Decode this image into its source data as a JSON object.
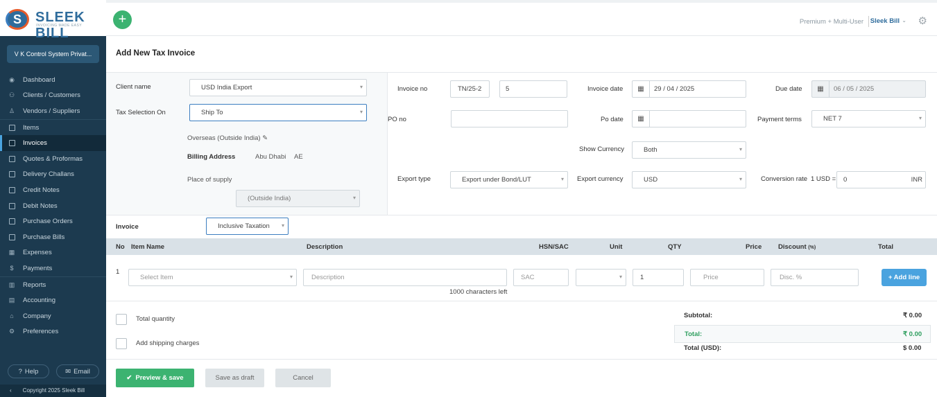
{
  "brand": {
    "badge": "S",
    "name": "SLEEK BILL",
    "tagline": "INVOICING MADE EASY"
  },
  "sidebar": {
    "company": "V K Control System Privat...",
    "items": [
      {
        "label": "Dashboard",
        "icon": "eye-icon"
      },
      {
        "label": "Clients / Customers",
        "icon": "users-icon"
      },
      {
        "label": "Vendors / Suppliers",
        "icon": "user-icon"
      },
      {
        "label": "Items",
        "icon": "box-icon"
      },
      {
        "label": "Invoices",
        "icon": "invoice-icon"
      },
      {
        "label": "Quotes & Proformas",
        "icon": "quote-icon"
      },
      {
        "label": "Delivery Challans",
        "icon": "delivery-icon"
      },
      {
        "label": "Credit Notes",
        "icon": "credit-note-icon"
      },
      {
        "label": "Debit Notes",
        "icon": "debit-note-icon"
      },
      {
        "label": "Purchase Orders",
        "icon": "purchase-order-icon"
      },
      {
        "label": "Purchase Bills",
        "icon": "purchase-bill-icon"
      },
      {
        "label": "Expenses",
        "icon": "expenses-icon"
      },
      {
        "label": "Payments",
        "icon": "dollar-icon"
      },
      {
        "label": "Reports",
        "icon": "chart-icon"
      },
      {
        "label": "Accounting",
        "icon": "accounting-icon"
      },
      {
        "label": "Company",
        "icon": "bank-icon"
      },
      {
        "label": "Preferences",
        "icon": "preferences-icon"
      }
    ],
    "help": "Help",
    "email": "Email",
    "copyright": "Copyright 2025 Sleek Bill"
  },
  "topbar": {
    "plan": "Premium + Multi-User",
    "user": "Sleek Bill"
  },
  "page": {
    "title": "Add New Tax Invoice"
  },
  "client": {
    "client_label": "Client name",
    "client_value": "USD India Export",
    "tax_label": "Tax Selection On",
    "tax_value": "Ship To",
    "overseas": "Overseas (Outside India)",
    "billing_label": "Billing Address",
    "billing_city": "Abu Dhabi",
    "billing_country": "AE",
    "supply_label": "Place of supply",
    "supply_value": "(Outside India)"
  },
  "invoice_info": {
    "invoice_no_label": "Invoice no",
    "invoice_prefix": "TN/25-2",
    "invoice_number": "5",
    "invoice_date_label": "Invoice date",
    "invoice_date": "29 / 04 / 2025",
    "due_date_label": "Due date",
    "due_date": "06 / 05 / 2025",
    "po_no_label": "PO no",
    "po_date_label": "Po date",
    "payment_terms_label": "Payment terms",
    "payment_terms": "NET 7",
    "show_currency_label": "Show Currency",
    "show_currency": "Both",
    "export_type_label": "Export type",
    "export_type": "Export under Bond/LUT",
    "export_currency_label": "Export currency",
    "export_currency": "USD",
    "conversion_label": "Conversion rate",
    "conversion_prefix": "1 USD =",
    "conversion_value": "0",
    "conversion_suffix": "INR"
  },
  "items": {
    "invoice_label": "Invoice",
    "taxation": "Inclusive Taxation",
    "headers": {
      "no": "No",
      "item": "Item Name",
      "desc": "Description",
      "hsn": "HSN/SAC",
      "unit": "Unit",
      "qty": "QTY",
      "price": "Price",
      "discount": "Discount",
      "discount_unit": "(%)",
      "total": "Total"
    },
    "row": {
      "no": "1",
      "item_placeholder": "Select Item",
      "desc_placeholder": "Description",
      "hsn_placeholder": "SAC",
      "qty": "1",
      "price_placeholder": "Price",
      "disc_placeholder": "Disc. %",
      "chars_left": "1000 characters left"
    },
    "add_line": "+ Add line"
  },
  "extras": {
    "total_qty": "Total quantity",
    "shipping": "Add shipping charges"
  },
  "totals": {
    "subtotal_label": "Subtotal:",
    "subtotal": "₹ 0.00",
    "total_label": "Total:",
    "total": "₹ 0.00",
    "total_usd_label": "Total (USD):",
    "total_usd": "$ 0.00"
  },
  "actions": {
    "preview": "Preview & save",
    "draft": "Save as draft",
    "cancel": "Cancel"
  },
  "colors": {
    "sidebar": "#1c3a4f",
    "accent": "#3cb371",
    "primary": "#4aa3df",
    "brand": "#2f6c9c"
  }
}
